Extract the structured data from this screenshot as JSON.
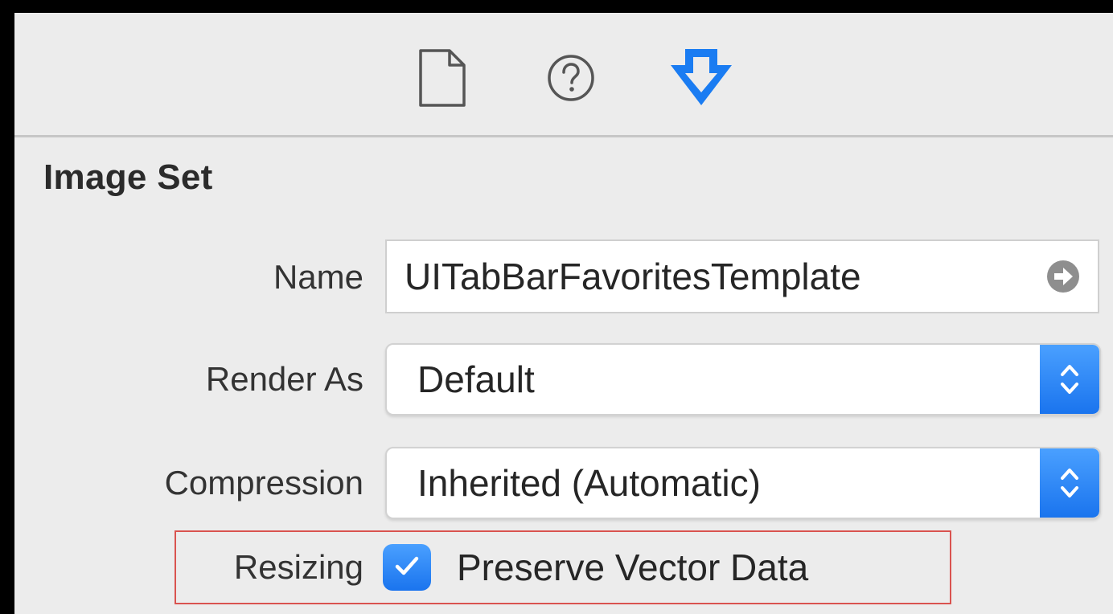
{
  "toolbar": {
    "tabs": [
      {
        "icon": "file-inspector-icon",
        "active": false
      },
      {
        "icon": "quick-help-icon",
        "active": false
      },
      {
        "icon": "attributes-inspector-icon",
        "active": true
      }
    ],
    "accent_color": "#1a7cf2"
  },
  "section": {
    "title": "Image Set"
  },
  "fields": {
    "name": {
      "label": "Name",
      "value": "UITabBarFavoritesTemplate"
    },
    "render_as": {
      "label": "Render As",
      "value": "Default"
    },
    "compression": {
      "label": "Compression",
      "value": "Inherited (Automatic)"
    },
    "resizing": {
      "label": "Resizing",
      "checkbox_label": "Preserve Vector Data",
      "checked": true
    }
  },
  "colors": {
    "panel_bg": "#ececec",
    "control_blue": "#1a74ee",
    "highlight_red": "#d9534f"
  }
}
